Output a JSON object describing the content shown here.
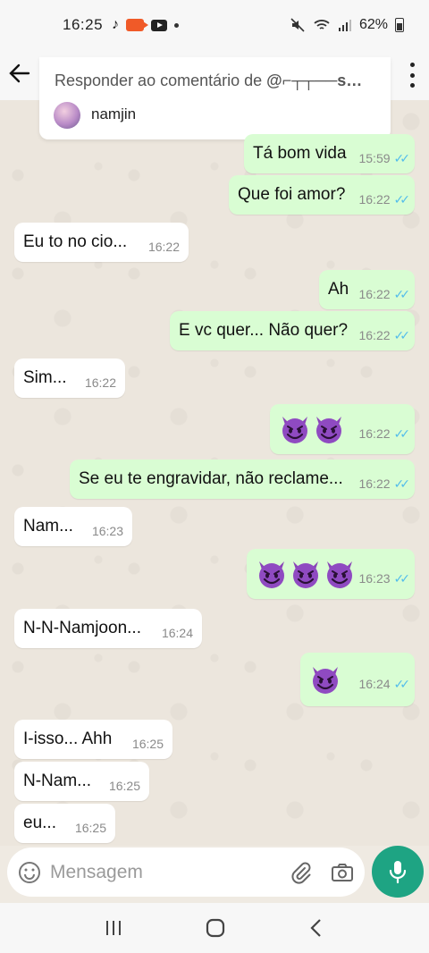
{
  "status_bar": {
    "time": "16:25",
    "battery": "62%"
  },
  "reply_overlay": {
    "prefix": "Responder ao comentário de ",
    "handle": "@⌐┬┬──s…",
    "name": "namjin"
  },
  "messages": [
    {
      "dir": "out",
      "text": "Tá bom vida",
      "time": "15:59"
    },
    {
      "dir": "out",
      "text": "Que foi amor?",
      "time": "16:22"
    },
    {
      "dir": "in",
      "text": "Eu to no cio...",
      "time": "16:22"
    },
    {
      "dir": "out",
      "text": "Ah",
      "time": "16:22"
    },
    {
      "dir": "out",
      "text": "E vc quer... Não quer?",
      "time": "16:22"
    },
    {
      "dir": "in",
      "text": "Sim...",
      "time": "16:22"
    },
    {
      "dir": "out",
      "emoji_count": 2,
      "time": "16:22"
    },
    {
      "dir": "out",
      "text": "Se eu te engravidar, não reclame...",
      "time": "16:22"
    },
    {
      "dir": "in",
      "text": "Nam...",
      "time": "16:23"
    },
    {
      "dir": "out",
      "emoji_count": 3,
      "time": "16:23"
    },
    {
      "dir": "in",
      "text": "N-N-Namjoon...",
      "time": "16:24"
    },
    {
      "dir": "out",
      "emoji_count": 1,
      "time": "16:24"
    },
    {
      "dir": "in",
      "text": "I-isso... Ahh",
      "time": "16:25"
    },
    {
      "dir": "in",
      "text": "N-Nam...",
      "time": "16:25"
    },
    {
      "dir": "in",
      "text": "eu...",
      "time": "16:25"
    }
  ],
  "composer": {
    "placeholder": "Mensagem"
  },
  "icons": {
    "back": "arrow-left-icon",
    "menu": "more-vert-icon",
    "emoji": "emoji-icon",
    "attach": "paperclip-icon",
    "camera": "camera-icon",
    "mic": "microphone-icon",
    "emoji_glyph": "smiling-devil-emoji"
  },
  "colors": {
    "outgoing_bubble": "#d9fdd3",
    "incoming_bubble": "#ffffff",
    "read_ticks": "#53bdeb",
    "mic_button": "#1ea483",
    "wallpaper": "#ece6dd"
  }
}
